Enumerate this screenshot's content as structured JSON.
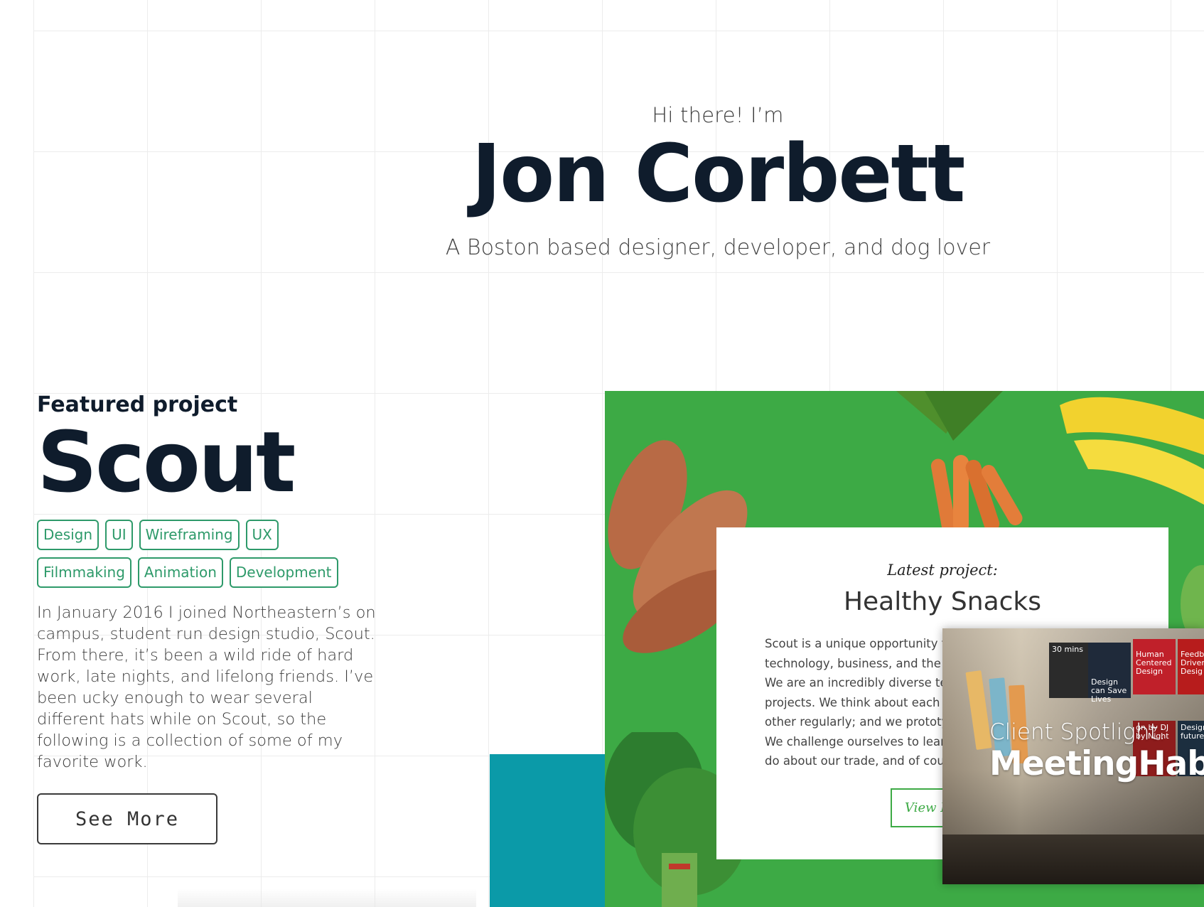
{
  "hero": {
    "greeting": "Hi there! I’m",
    "name": "Jon Corbett",
    "tagline": "A Boston based designer, developer, and dog lover"
  },
  "featured": {
    "label": "Featured project",
    "title": "Scout",
    "tags": [
      "Design",
      "UI",
      "Wireframing",
      "UX",
      "Filmmaking",
      "Animation",
      "Development"
    ],
    "description": "In January 2016 I joined Northeastern’s on campus, student run design studio, Scout. From there, it’s been a wild ride of hard work, late nights, and lifelong friends. I’ve been ucky enough to wear several different hats while on Scout, so the following is a collection of some of my favorite work.",
    "button_label": "See More"
  },
  "showcase": {
    "card": {
      "kicker": "Latest project:",
      "title": "Healthy Snacks",
      "body_lines": [
        "Scout is a unique opportunity to le",
        "technology, business, and the soc",
        "We are an incredibly diverse team",
        "projects. We think about each pro",
        "other regularly; and we prototype",
        "We challenge ourselves to learn a",
        "do about our trade, and  of cours"
      ],
      "button_label": "View P"
    },
    "spotlight": {
      "label": "Client Spotlight:",
      "title": "MeetingHabi",
      "posters": [
        {
          "text": "30 mins"
        },
        {
          "text": "Design can Save Lives"
        },
        {
          "text": "Human Centered Design"
        },
        {
          "text": "Feedb Driven Desig"
        },
        {
          "text": "gn by DJ by Night"
        },
        {
          "text": "Design future"
        }
      ]
    },
    "colors": {
      "green": "#3daa45",
      "teal": "#0b9aa8",
      "tag": "#2e9a6a"
    }
  }
}
